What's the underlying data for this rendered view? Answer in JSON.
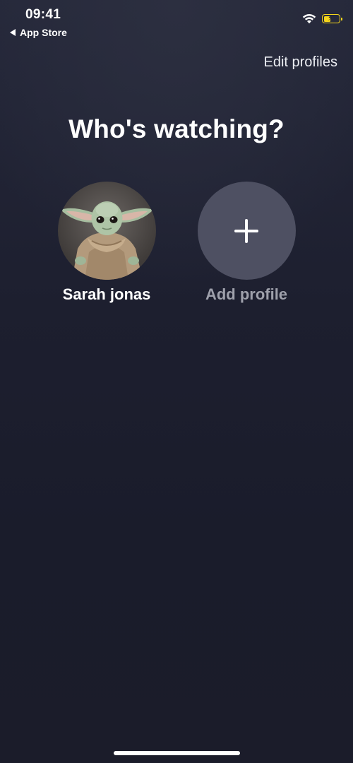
{
  "status_bar": {
    "time": "09:41",
    "back_label": "App Store",
    "icons": [
      "wifi-icon",
      "battery-charging-icon"
    ],
    "battery_level": 0.4,
    "battery_color": "#f5d51b"
  },
  "header": {
    "edit_label": "Edit profiles",
    "title": "Who's watching?"
  },
  "profiles": [
    {
      "name": "Sarah jonas",
      "avatar": "baby-yoda-avatar"
    },
    {
      "name": "Add profile",
      "icon": "plus-icon"
    }
  ],
  "colors": {
    "background": "#1d1f2f",
    "add_circle": "#4e5062",
    "muted_text": "#9ea0ab"
  }
}
